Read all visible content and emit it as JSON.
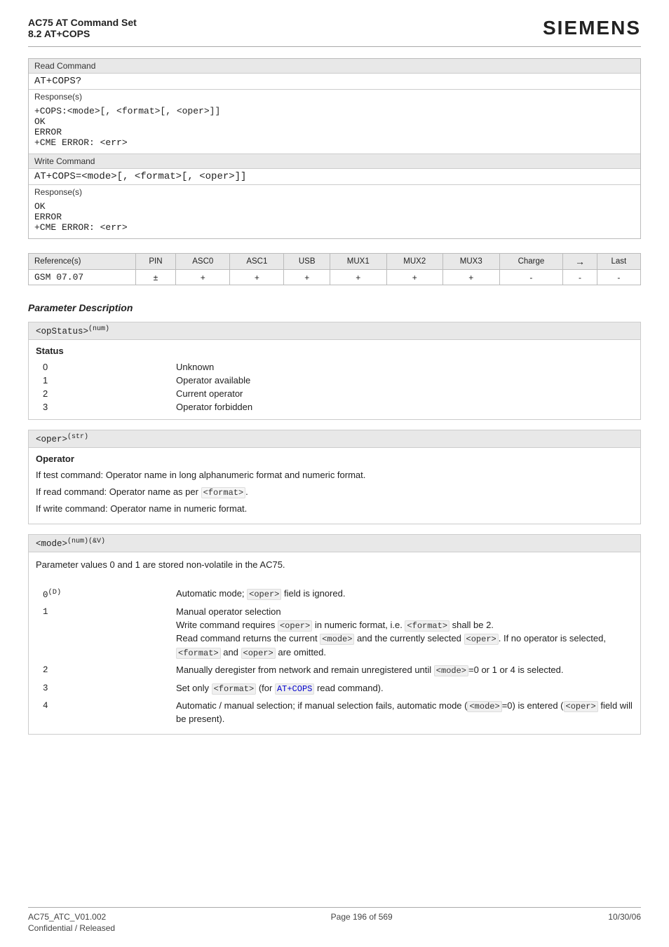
{
  "header": {
    "title": "AC75 AT Command Set",
    "subtitle": "8.2 AT+COPS",
    "brand": "SIEMENS"
  },
  "read_command": {
    "label": "Read Command",
    "cmd": "AT+COPS?",
    "response_label": "Response(s)",
    "response_lines": [
      "+COPS:<mode>[, <format>[, <oper>]]",
      "OK",
      "ERROR",
      "+CME ERROR: <err>"
    ]
  },
  "write_command": {
    "label": "Write Command",
    "cmd": "AT+COPS=<mode>[, <format>[, <oper>]]",
    "response_label": "Response(s)",
    "response_lines": [
      "OK",
      "ERROR",
      "+CME ERROR: <err>"
    ]
  },
  "reference_table": {
    "headers": [
      "PIN",
      "ASC0",
      "ASC1",
      "USB",
      "MUX1",
      "MUX2",
      "MUX3",
      "Charge",
      "→",
      "Last"
    ],
    "row_label": "GSM 07.07",
    "row_values": [
      "±",
      "+",
      "+",
      "+",
      "+",
      "+",
      "+",
      "-",
      "-",
      "-"
    ]
  },
  "section_title": "Parameter Description",
  "param1": {
    "header_text": "<opStatus>",
    "header_sup": "(num)",
    "subtitle": "Status",
    "rows": [
      {
        "val": "0",
        "desc": "Unknown"
      },
      {
        "val": "1",
        "desc": "Operator available"
      },
      {
        "val": "2",
        "desc": "Current operator"
      },
      {
        "val": "3",
        "desc": "Operator forbidden"
      }
    ]
  },
  "param2": {
    "header_text": "<oper>",
    "header_sup": "(str)",
    "subtitle": "Operator",
    "lines": [
      "If test command: Operator name in long alphanumeric format and numeric format.",
      "If read command: Operator name as per <format>.",
      "If write command: Operator name in numeric format."
    ]
  },
  "param3": {
    "header_text": "<mode>",
    "header_sup": "(num)(&V)",
    "intro": "Parameter values 0 and 1 are stored non-volatile in the AC75.",
    "rows": [
      {
        "val": "0(D)",
        "desc_parts": [
          {
            "type": "text",
            "text": "Automatic mode; "
          },
          {
            "type": "mono",
            "text": "<oper>"
          },
          {
            "type": "text",
            "text": " field is ignored."
          }
        ]
      },
      {
        "val": "1",
        "desc_parts": [
          {
            "type": "text",
            "text": "Manual operator selection"
          },
          {
            "type": "newline"
          },
          {
            "type": "text",
            "text": "Write command requires "
          },
          {
            "type": "mono",
            "text": "<oper>"
          },
          {
            "type": "text",
            "text": " in numeric format, i.e. "
          },
          {
            "type": "mono",
            "text": "<format>"
          },
          {
            "type": "text",
            "text": " shall be 2."
          },
          {
            "type": "newline"
          },
          {
            "type": "text",
            "text": "Read command returns the current "
          },
          {
            "type": "mono",
            "text": "<mode>"
          },
          {
            "type": "text",
            "text": " and the currently selected "
          },
          {
            "type": "mono",
            "text": "<oper>"
          },
          {
            "type": "text",
            "text": ". If no operator is selected, "
          },
          {
            "type": "mono",
            "text": "<format>"
          },
          {
            "type": "text",
            "text": " and "
          },
          {
            "type": "mono",
            "text": "<oper>"
          },
          {
            "type": "text",
            "text": " are omitted."
          }
        ]
      },
      {
        "val": "2",
        "desc_parts": [
          {
            "type": "text",
            "text": "Manually deregister from network and remain unregistered until "
          },
          {
            "type": "mono",
            "text": "<mode>"
          },
          {
            "type": "text",
            "text": "=0 or 1 or 4 is selected."
          }
        ]
      },
      {
        "val": "3",
        "desc_parts": [
          {
            "type": "text",
            "text": "Set only "
          },
          {
            "type": "mono",
            "text": "<format>"
          },
          {
            "type": "text",
            "text": " (for "
          },
          {
            "type": "bluemono",
            "text": "AT+COPS"
          },
          {
            "type": "text",
            "text": " read command)."
          }
        ]
      },
      {
        "val": "4",
        "desc_parts": [
          {
            "type": "text",
            "text": "Automatic / manual selection; if manual selection fails, automatic mode ("
          },
          {
            "type": "mono",
            "text": "<mode>"
          },
          {
            "type": "text",
            "text": "=0) is entered ("
          },
          {
            "type": "mono",
            "text": "<oper>"
          },
          {
            "type": "text",
            "text": " field will be present)."
          }
        ]
      }
    ]
  },
  "footer": {
    "left1": "AC75_ATC_V01.002",
    "left2": "Confidential / Released",
    "center": "Page 196 of 569",
    "right": "10/30/06"
  }
}
